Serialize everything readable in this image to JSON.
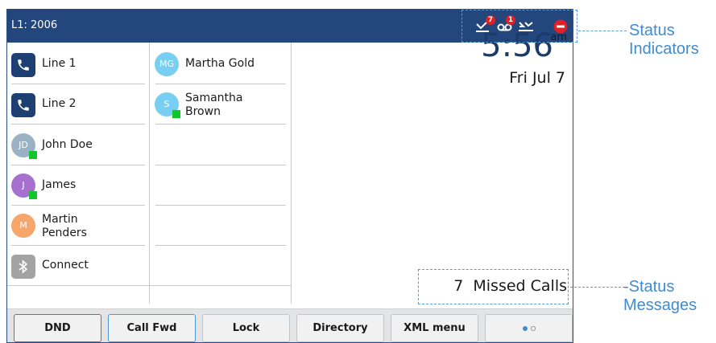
{
  "phone": {
    "line_title": "L1: 2006",
    "status_icons": [
      {
        "name": "missed-call-icon",
        "badge": "7"
      },
      {
        "name": "voicemail-icon",
        "badge": "1"
      },
      {
        "name": "call-forward-icon",
        "badge": ""
      },
      {
        "name": "dnd-icon",
        "badge": ""
      }
    ],
    "left_column": [
      {
        "type": "line",
        "label": "Line 1",
        "icon": "phone-icon"
      },
      {
        "type": "line",
        "label": "Line 2",
        "icon": "phone-icon"
      },
      {
        "type": "contact",
        "initials": "JD",
        "label": "John Doe",
        "avatar_color": "#9bb2c4",
        "presence": true
      },
      {
        "type": "contact",
        "initials": "J",
        "label": "James",
        "avatar_color": "#a770cf",
        "presence": true
      },
      {
        "type": "contact",
        "initials": "M",
        "label": "Martin\nPenders",
        "avatar_color": "#f6a56b",
        "presence": false
      },
      {
        "type": "bluetooth",
        "label": "Connect",
        "icon": "bluetooth-icon"
      }
    ],
    "middle_column": [
      {
        "initials": "MG",
        "label": "Martha Gold",
        "avatar_color": "#79cff2",
        "presence": false
      },
      {
        "initials": "S",
        "label": "Samantha\nBrown",
        "avatar_color": "#79cff2",
        "presence": true
      }
    ],
    "clock": {
      "time": "5:56",
      "ampm": "am",
      "date": "Fri Jul 7"
    },
    "status_message": "7  Missed Calls",
    "softkeys": [
      {
        "label": "DND",
        "state": "selected-red"
      },
      {
        "label": "Call Fwd",
        "state": "selected-blue"
      },
      {
        "label": "Lock",
        "state": "normal"
      },
      {
        "label": "Directory",
        "state": "normal"
      },
      {
        "label": "XML menu",
        "state": "normal"
      },
      {
        "label": "",
        "state": "pager"
      }
    ]
  },
  "callouts": {
    "indicators": "Status\nIndicators",
    "messages": "-Status\nMessages"
  },
  "colors": {
    "title_bar": "#23467c",
    "presence_green": "#11c52b",
    "badge_red": "#e02024",
    "callout_blue": "#3f8cd0",
    "phone_icon_bg": "#1d3f72"
  }
}
